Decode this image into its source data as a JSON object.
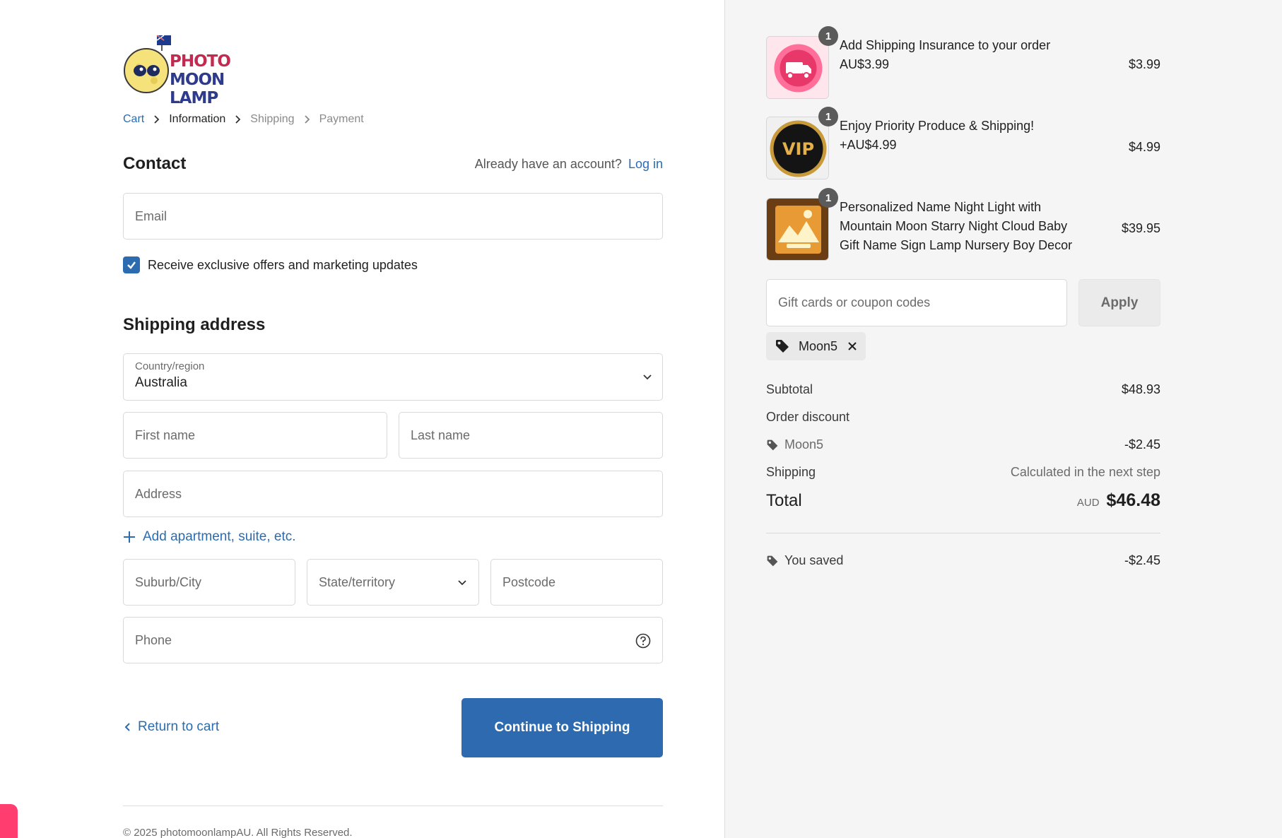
{
  "brand": {
    "logo_line1": "PHOTO",
    "logo_line2": "MOON LAMP"
  },
  "breadcrumb": [
    "Cart",
    "Information",
    "Shipping",
    "Payment"
  ],
  "contact": {
    "title": "Contact",
    "account_prompt": "Already have an account?",
    "login_label": "Log in",
    "email_placeholder": "Email",
    "marketing_label": "Receive exclusive offers and marketing updates",
    "marketing_checked": true
  },
  "shipping": {
    "title": "Shipping address",
    "country_label": "Country/region",
    "country_value": "Australia",
    "first_name_placeholder": "First name",
    "last_name_placeholder": "Last name",
    "address_placeholder": "Address",
    "add_apartment_label": "Add apartment, suite, etc.",
    "city_placeholder": "Suburb/City",
    "state_label": "State/territory",
    "postcode_placeholder": "Postcode",
    "phone_placeholder": "Phone"
  },
  "actions": {
    "return_label": "Return to cart",
    "continue_label": "Continue to Shipping"
  },
  "footer": {
    "copyright": "© 2025 photomoonlampAU. All Rights Reserved."
  },
  "order": {
    "items": [
      {
        "qty": "1",
        "name_lines": [
          "Add Shipping Insurance to your order",
          "AU$3.99"
        ],
        "price": "$3.99",
        "thumb_icon": "shipping-truck-badge"
      },
      {
        "qty": "1",
        "name_lines": [
          "Enjoy Priority Produce & Shipping!",
          "+AU$4.99"
        ],
        "price": "$4.99",
        "thumb_icon": "vip-badge"
      },
      {
        "qty": "1",
        "name_lines": [
          "Personalized Name Night Light with",
          "Mountain Moon Starry Night Cloud Baby",
          "Gift Name Sign Lamp Nursery Boy Decor"
        ],
        "price": "$39.95",
        "thumb_icon": "night-light-photo"
      }
    ],
    "coupon_placeholder": "Gift cards or coupon codes",
    "apply_label": "Apply",
    "applied_code": "Moon5",
    "subtotal_label": "Subtotal",
    "subtotal_value": "$48.93",
    "order_discount_label": "Order discount",
    "discount_code": "Moon5",
    "discount_value": "-$2.45",
    "shipping_label": "Shipping",
    "shipping_value": "Calculated in the next step",
    "total_label": "Total",
    "currency": "AUD",
    "total_value": "$46.48",
    "saved_label": "You saved",
    "saved_value": "-$2.45"
  },
  "colors": {
    "accent": "#2b6cb0",
    "button": "#2d6aaf",
    "panel_bg": "#f5f5f5"
  }
}
